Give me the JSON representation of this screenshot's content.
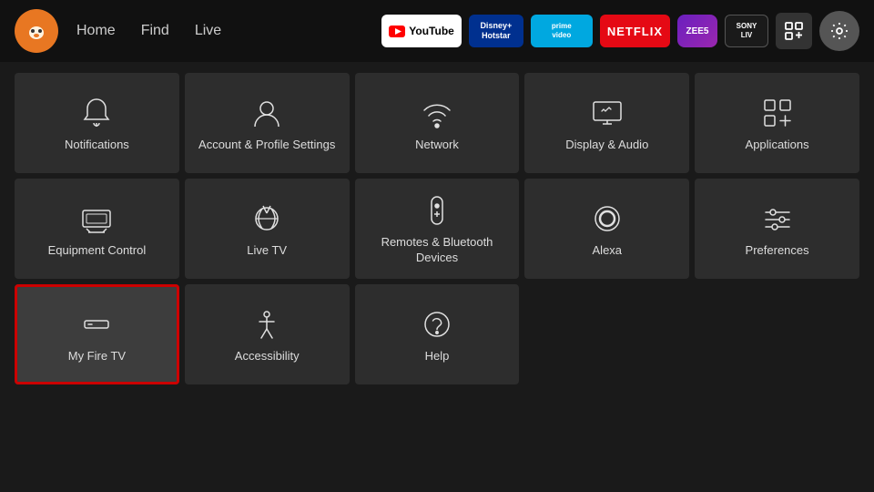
{
  "nav": {
    "links": [
      {
        "label": "Home",
        "id": "home"
      },
      {
        "label": "Find",
        "id": "find"
      },
      {
        "label": "Live",
        "id": "live"
      }
    ],
    "apps": [
      {
        "label": "▶ YouTube",
        "class": "app-youtube",
        "id": "youtube"
      },
      {
        "label": "Disney+ Hotstar",
        "class": "app-disney",
        "id": "disney"
      },
      {
        "label": "prime video",
        "class": "app-prime",
        "id": "prime"
      },
      {
        "label": "NETFLIX",
        "class": "app-netflix",
        "id": "netflix"
      },
      {
        "label": "ZEE5",
        "class": "app-zee5",
        "id": "zee5"
      },
      {
        "label": "SONY LIV",
        "class": "app-sony",
        "id": "sony"
      }
    ]
  },
  "tiles": [
    {
      "id": "notifications",
      "label": "Notifications",
      "icon": "bell",
      "row": 1,
      "selected": false
    },
    {
      "id": "account-profile",
      "label": "Account & Profile Settings",
      "icon": "person",
      "row": 1,
      "selected": false
    },
    {
      "id": "network",
      "label": "Network",
      "icon": "wifi",
      "row": 1,
      "selected": false
    },
    {
      "id": "display-audio",
      "label": "Display & Audio",
      "icon": "display",
      "row": 1,
      "selected": false
    },
    {
      "id": "applications",
      "label": "Applications",
      "icon": "apps",
      "row": 1,
      "selected": false
    },
    {
      "id": "equipment-control",
      "label": "Equipment Control",
      "icon": "tv",
      "row": 2,
      "selected": false
    },
    {
      "id": "live-tv",
      "label": "Live TV",
      "icon": "antenna",
      "row": 2,
      "selected": false
    },
    {
      "id": "remotes-bluetooth",
      "label": "Remotes & Bluetooth Devices",
      "icon": "remote",
      "row": 2,
      "selected": false
    },
    {
      "id": "alexa",
      "label": "Alexa",
      "icon": "alexa",
      "row": 2,
      "selected": false
    },
    {
      "id": "preferences",
      "label": "Preferences",
      "icon": "sliders",
      "row": 2,
      "selected": false
    },
    {
      "id": "my-fire-tv",
      "label": "My Fire TV",
      "icon": "firetv",
      "row": 3,
      "selected": true
    },
    {
      "id": "accessibility",
      "label": "Accessibility",
      "icon": "accessibility",
      "row": 3,
      "selected": false
    },
    {
      "id": "help",
      "label": "Help",
      "icon": "help",
      "row": 3,
      "selected": false
    }
  ]
}
